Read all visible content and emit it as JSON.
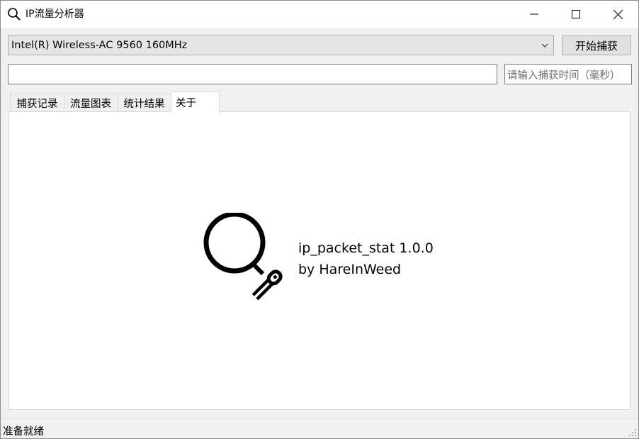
{
  "window": {
    "title": "IP流量分析器",
    "icon": "search-icon",
    "controls": [
      "minimize-icon",
      "maximize-icon",
      "close-icon"
    ]
  },
  "capture": {
    "device": "Intel(R) Wireless-AC 9560 160MHz",
    "start_label": "开始捕获",
    "filter_value": "",
    "time_placeholder": "请输入捕获时间（毫秒）"
  },
  "tabs": [
    {
      "label": "捕获记录",
      "active": false
    },
    {
      "label": "流量图表",
      "active": false
    },
    {
      "label": "统计结果",
      "active": false
    },
    {
      "label": "关于",
      "active": true
    }
  ],
  "about": {
    "logo": "magnifier-logo-icon",
    "app_name": "ip_packet_stat 1.0.0",
    "author": "by HareInWeed"
  },
  "status": {
    "text": "准备就绪"
  },
  "colors": {
    "window_bg": "#f0f0f0",
    "panel_bg": "#ffffff",
    "border": "#adadad"
  }
}
